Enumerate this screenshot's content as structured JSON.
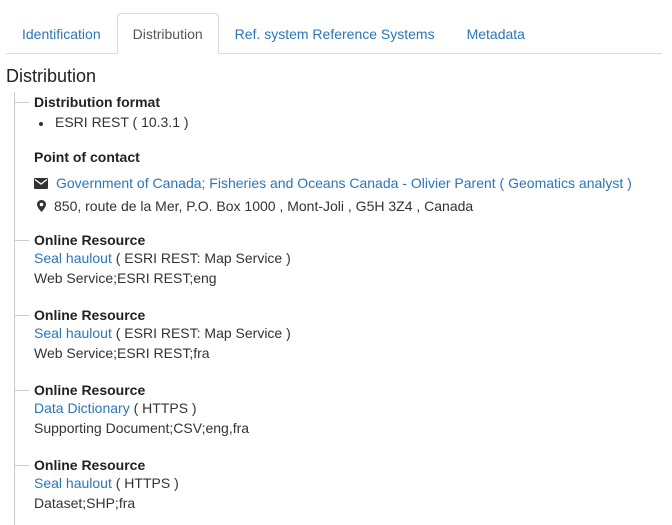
{
  "tabs": [
    {
      "label": "Identification"
    },
    {
      "label": "Distribution"
    },
    {
      "label": "Ref. system Reference Systems"
    },
    {
      "label": "Metadata"
    }
  ],
  "section_title": "Distribution",
  "distribution_format": {
    "title": "Distribution format",
    "items": [
      "ESRI REST ( 10.3.1 )"
    ]
  },
  "point_of_contact": {
    "title": "Point of contact",
    "email_link": "Government of Canada; Fisheries and Oceans Canada - Olivier Parent ( Geomatics analyst )",
    "address": "850, route de la Mer, P.O. Box 1000 , Mont-Joli , G5H 3Z4 , Canada"
  },
  "online_resources": [
    {
      "title": "Online Resource",
      "link": "Seal haulout",
      "protocol": " ( ESRI REST: Map Service )",
      "description": "Web Service;ESRI REST;eng"
    },
    {
      "title": "Online Resource",
      "link": "Seal haulout",
      "protocol": " ( ESRI REST: Map Service )",
      "description": "Web Service;ESRI REST;fra"
    },
    {
      "title": "Online Resource",
      "link": "Data Dictionary",
      "protocol": " ( HTTPS )",
      "description": "Supporting Document;CSV;eng,fra"
    },
    {
      "title": "Online Resource",
      "link": "Seal haulout",
      "protocol": " ( HTTPS )",
      "description": "Dataset;SHP;fra"
    }
  ],
  "icons": {
    "email": "envelope-icon",
    "address": "map-marker-icon"
  },
  "colors": {
    "link": "#2a76b8",
    "border": "#dddddd"
  }
}
